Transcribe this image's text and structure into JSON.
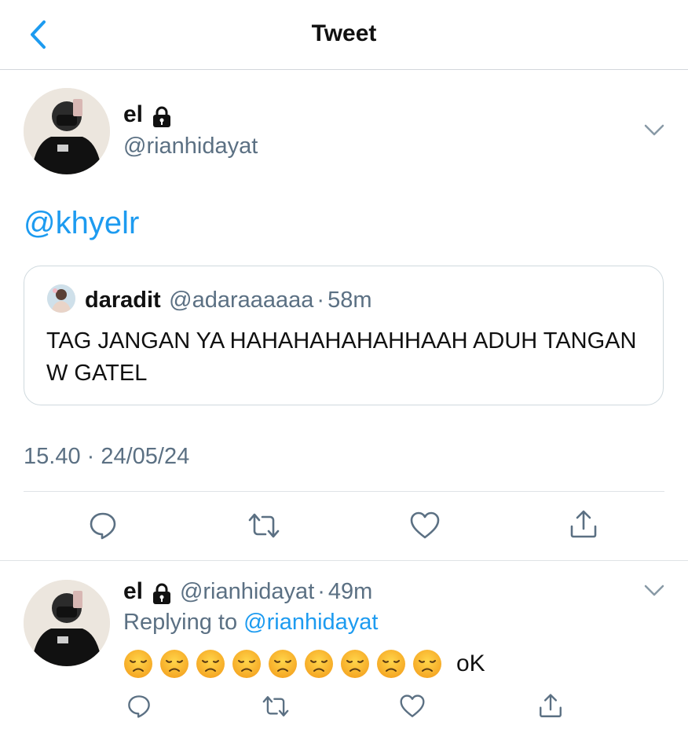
{
  "header": {
    "title": "Tweet"
  },
  "tweet": {
    "name": "el",
    "handle": "@rianhidayat",
    "text": "@khyelr",
    "quote": {
      "name": "daradit",
      "handle": "@adaraaaaaa",
      "separator": "·",
      "time": "58m",
      "text": "TAG JANGAN YA HAHAHAHAHAHHAAH ADUH TANGAN W GATEL"
    },
    "timestamp": "15.40 · 24/05/24"
  },
  "reply": {
    "name": "el",
    "handle": "@rianhidayat",
    "separator": "·",
    "time": "49m",
    "replying_prefix": "Replying to",
    "replying_to": "@rianhidayat",
    "emoji_count": 9,
    "emoji_name": "disappointed-face",
    "text": "oK"
  },
  "icons": {
    "back": "chevron-left-icon",
    "lock": "lock-icon",
    "more": "chevron-down-icon",
    "reply": "comment-icon",
    "retweet": "retweet-icon",
    "like": "heart-icon",
    "share": "share-icon"
  },
  "colors": {
    "accent": "#1d9bf0",
    "secondary_text": "#5b7083",
    "divider": "#dfe3e6"
  }
}
